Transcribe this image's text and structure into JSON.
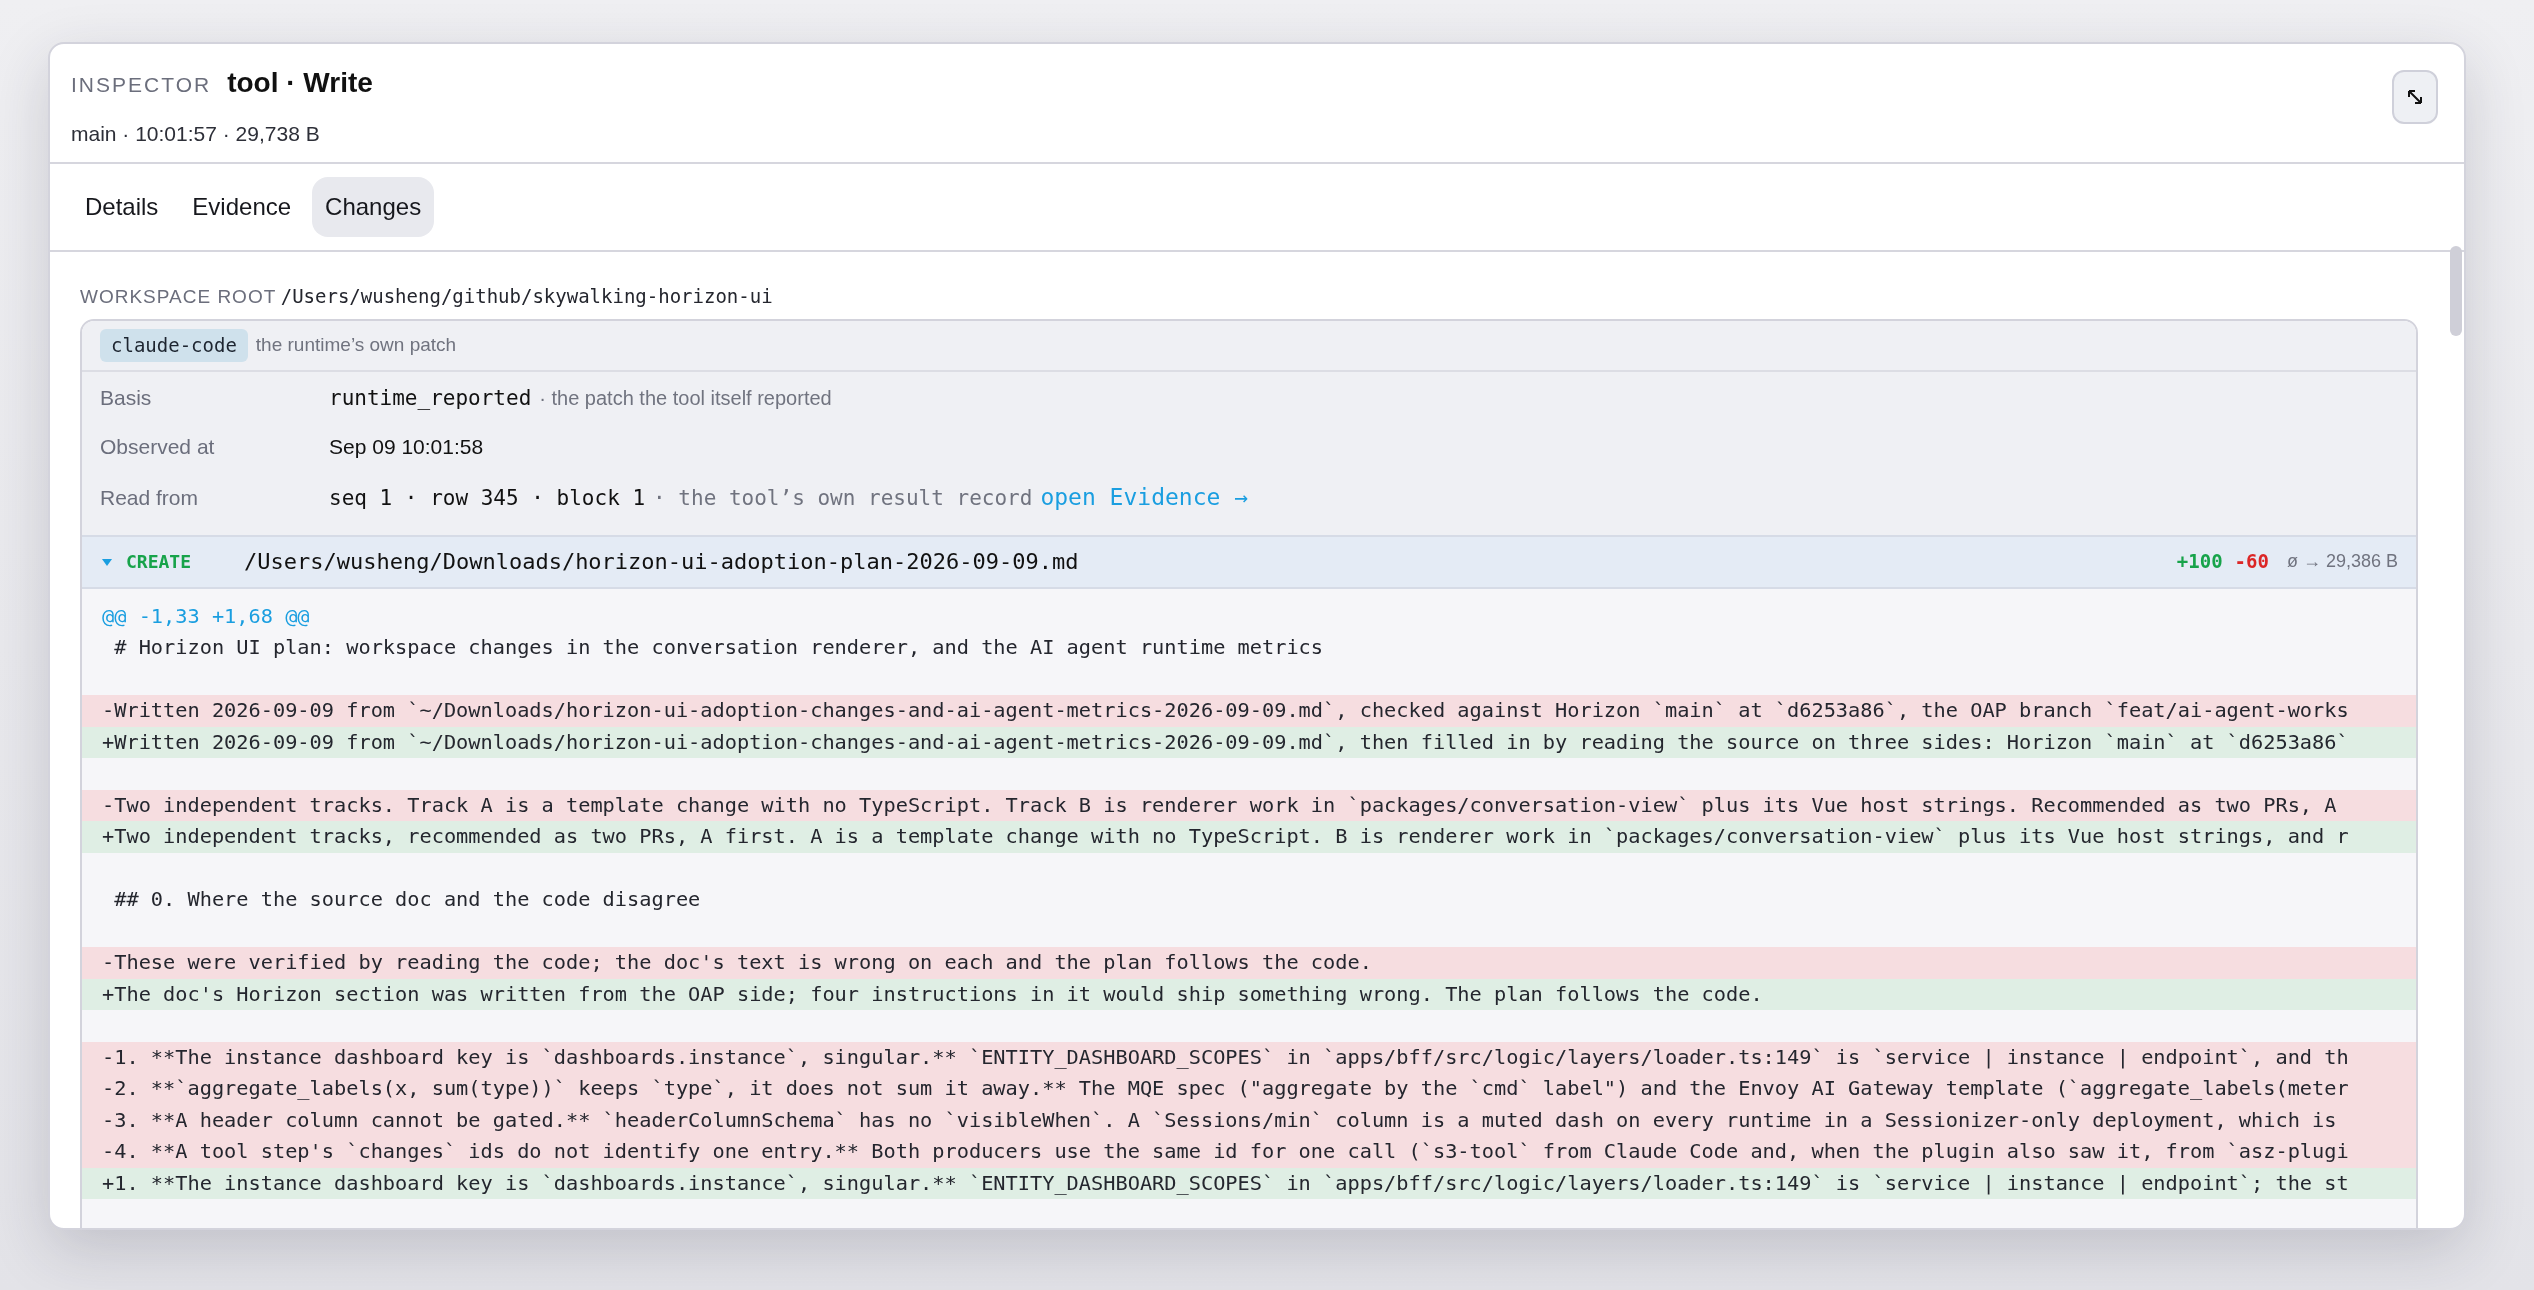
{
  "inspector": {
    "label": "INSPECTOR",
    "title": "tool · Write",
    "subtitle": "main · 10:01:57 · 29,738 B"
  },
  "tabs": [
    {
      "label": "Details",
      "selected": false
    },
    {
      "label": "Evidence",
      "selected": false
    },
    {
      "label": "Changes",
      "selected": true
    }
  ],
  "workspace_root": {
    "label": "WORKSPACE ROOT",
    "path": "/Users/wusheng/github/skywalking-horizon-ui"
  },
  "patch": {
    "source_tag": "claude-code",
    "source_note": "the runtime’s own patch",
    "fields": [
      {
        "label": "Basis",
        "value": "runtime_reported",
        "kind": "code",
        "note": {
          "text": "· the patch the tool itself reported",
          "kind": "text"
        }
      },
      {
        "label": "Observed at",
        "value": "Sep 09 10:01:58",
        "kind": "text"
      },
      {
        "label": "Read from",
        "value": "seq 1 · row 345 · block 1",
        "kind": "code",
        "note": {
          "text": "· the tool’s own result record",
          "kind": "code"
        },
        "link": "open Evidence →"
      }
    ]
  },
  "file": {
    "expanded": true,
    "action": "CREATE",
    "path": "/Users/wusheng/Downloads/horizon-ui-adoption-plan-2026-09-09.md",
    "added": "+100",
    "removed": "-60",
    "size": "ø → 29,386 B"
  },
  "diff": {
    "hunk": "@@ -1,33 +1,68 @@",
    "lines": [
      {
        "kind": "context",
        "text": " # Horizon UI plan: workspace changes in the conversation renderer, and the AI agent runtime metrics"
      },
      {
        "kind": "blank"
      },
      {
        "kind": "removed",
        "text": "-Written 2026-09-09 from `~/Downloads/horizon-ui-adoption-changes-and-ai-agent-metrics-2026-09-09.md`, checked against Horizon `main` at `d6253a86`, the OAP branch `feat/ai-agent-works"
      },
      {
        "kind": "added",
        "text": "+Written 2026-09-09 from `~/Downloads/horizon-ui-adoption-changes-and-ai-agent-metrics-2026-09-09.md`, then filled in by reading the source on three sides: Horizon `main` at `d6253a86`"
      },
      {
        "kind": "blank"
      },
      {
        "kind": "removed",
        "text": "-Two independent tracks. Track A is a template change with no TypeScript. Track B is renderer work in `packages/conversation-view` plus its Vue host strings. Recommended as two PRs, A"
      },
      {
        "kind": "added",
        "text": "+Two independent tracks, recommended as two PRs, A first. A is a template change with no TypeScript. B is renderer work in `packages/conversation-view` plus its Vue host strings, and r"
      },
      {
        "kind": "blank"
      },
      {
        "kind": "context",
        "text": " ## 0. Where the source doc and the code disagree"
      },
      {
        "kind": "blank"
      },
      {
        "kind": "removed",
        "text": "-These were verified by reading the code; the doc's text is wrong on each and the plan follows the code."
      },
      {
        "kind": "added",
        "text": "+The doc's Horizon section was written from the OAP side; four instructions in it would ship something wrong. The plan follows the code."
      },
      {
        "kind": "blank"
      },
      {
        "kind": "removed",
        "text": "-1. **The instance dashboard key is `dashboards.instance`, singular.** `ENTITY_DASHBOARD_SCOPES` in `apps/bff/src/logic/layers/loader.ts:149` is `service | instance | endpoint`, and th"
      },
      {
        "kind": "removed",
        "text": "-2. **`aggregate_labels(x, sum(type))` keeps `type`, it does not sum it away.** The MQE spec (\"aggregate by the `cmd` label\") and the Envoy AI Gateway template (`aggregate_labels(meter"
      },
      {
        "kind": "removed",
        "text": "-3. **A header column cannot be gated.** `headerColumnSchema` has no `visibleWhen`. A `Sessions/min` column is a muted dash on every runtime in a Sessionizer-only deployment, which is"
      },
      {
        "kind": "removed",
        "text": "-4. **A tool step's `changes` ids do not identify one entry.** Both producers use the same id for one call (`s3-tool` from Claude Code and, when the plugin also saw it, from `asz-plugi"
      },
      {
        "kind": "added",
        "text": "+1. **The instance dashboard key is `dashboards.instance`, singular.** `ENTITY_DASHBOARD_SCOPES` in `apps/bff/src/logic/layers/loader.ts:149` is `service | instance | endpoint`; the st"
      }
    ]
  }
}
